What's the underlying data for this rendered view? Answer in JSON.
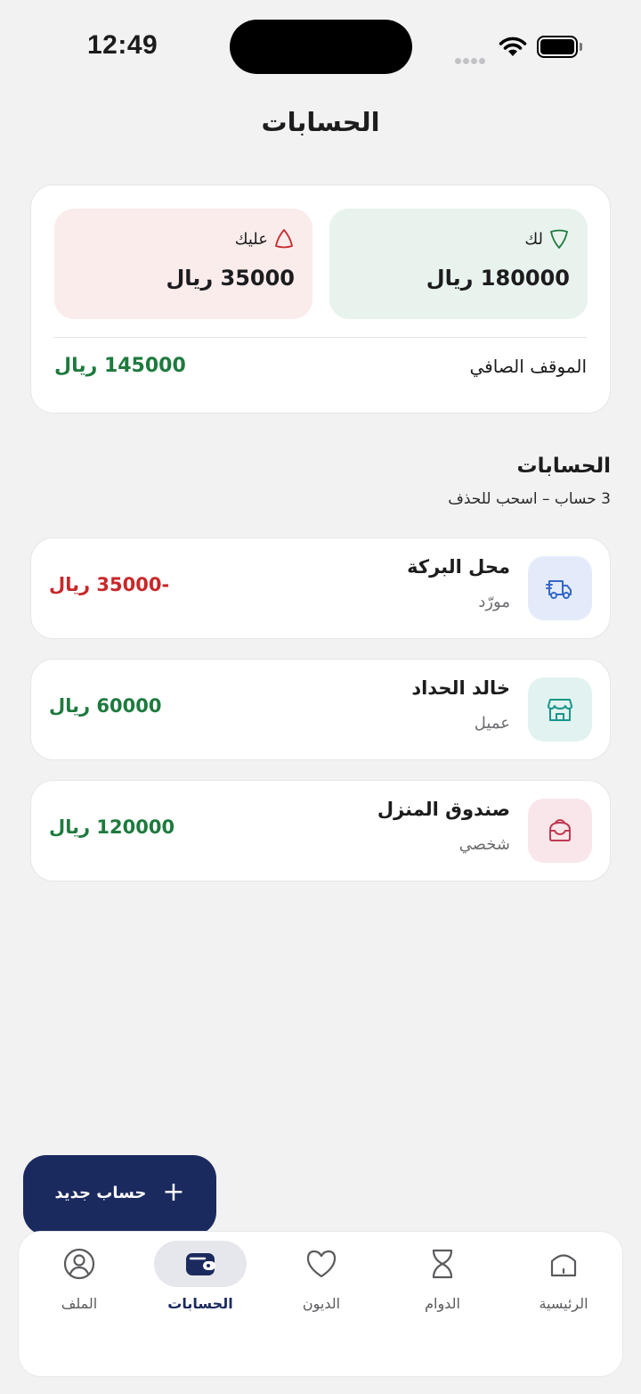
{
  "status_bar": {
    "time": "12:49"
  },
  "header": {
    "title": "الحسابات"
  },
  "summary": {
    "credit_label": "لك",
    "credit_amount": "180000 ريال",
    "debit_label": "عليك",
    "debit_amount": "35000 ريال",
    "net_label": "الموقف الصافي",
    "net_amount": "145000 ريال"
  },
  "section": {
    "title": "الحسابات",
    "subtitle": "3 حساب – اسحب للحذف"
  },
  "accounts": [
    {
      "name": "محل البركة",
      "type": "مورّد",
      "amount": "-35000 ريال",
      "icon": "truck-icon",
      "icon_bg": "#e3ebfb",
      "icon_color": "#3566c8",
      "amount_color": "#c8282b"
    },
    {
      "name": "خالد الحداد",
      "type": "عميل",
      "amount": "60000 ريال",
      "icon": "store-icon",
      "icon_bg": "#e2f2f0",
      "icon_color": "#16978a",
      "amount_color": "#1e7a3e"
    },
    {
      "name": "صندوق المنزل",
      "type": "شخصي",
      "amount": "120000 ريال",
      "icon": "piggy-bank-icon",
      "icon_bg": "#f8e6ea",
      "icon_color": "#c03a52",
      "amount_color": "#1e7a3e"
    }
  ],
  "fab": {
    "label": "حساب جديد"
  },
  "nav": {
    "items": [
      {
        "label": "الرئيسية",
        "icon": "home-icon"
      },
      {
        "label": "الدوام",
        "icon": "hourglass-icon"
      },
      {
        "label": "الديون",
        "icon": "heart-icon"
      },
      {
        "label": "الحسابات",
        "icon": "wallet-icon"
      },
      {
        "label": "الملف",
        "icon": "profile-icon"
      }
    ],
    "active": "الحسابات"
  },
  "colors": {
    "primary": "#1b2a5e",
    "positive": "#1e7a3e",
    "negative": "#c8282b"
  }
}
